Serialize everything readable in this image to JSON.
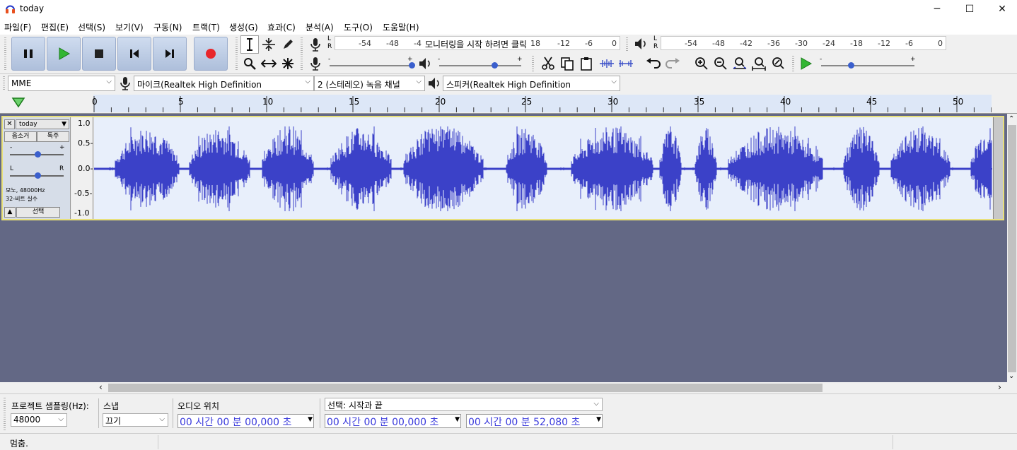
{
  "window": {
    "title": "today",
    "minimize": "─",
    "maximize": "☐",
    "close": "✕"
  },
  "menu": [
    "파일(F)",
    "편집(E)",
    "선택(S)",
    "보기(V)",
    "구동(N)",
    "트랙(T)",
    "생성(G)",
    "효과(C)",
    "분석(A)",
    "도구(O)",
    "도움말(H)"
  ],
  "meters": {
    "record_ticks": [
      "-54",
      "-48",
      "-4",
      "18",
      "-12",
      "-6",
      "0"
    ],
    "record_hint": "모니터링을 시작 하려면 클릭",
    "play_ticks": [
      "-54",
      "-48",
      "-42",
      "-36",
      "-30",
      "-24",
      "-18",
      "-12",
      "-6",
      "0"
    ],
    "lr": [
      "L",
      "R"
    ]
  },
  "sliders": {
    "minus": "-",
    "plus": "+"
  },
  "devices": {
    "host": "MME",
    "input": "마이크(Realtek High Definition",
    "channels": "2 (스테레오) 녹음 채널",
    "output": "스피커(Realtek High Definition"
  },
  "ruler": {
    "labels": [
      "0",
      "5",
      "10",
      "15",
      "20",
      "25",
      "30",
      "35",
      "40",
      "45",
      "50"
    ]
  },
  "track": {
    "name": "today",
    "mute": "음소거",
    "solo": "독주",
    "gain_minus": "-",
    "gain_plus": "+",
    "pan_left": "L",
    "pan_right": "R",
    "info1": "모노, 48000Hz",
    "info2": "32-비트 실수",
    "select": "선택",
    "vscale": [
      "1.0",
      "0.5-",
      "0.0-",
      "-0.5-",
      "-1.0"
    ]
  },
  "selection": {
    "rate_label": "프로젝트 샘플링(Hz):",
    "rate_value": "48000",
    "snap_label": "스냅",
    "snap_value": "끄기",
    "pos_label": "오디오 위치",
    "pos_value": "00 시간 00 분 00,000 초",
    "sel_label": "선택: 시작과 끝",
    "sel_start": "00 시간 00 분 00,000 초",
    "sel_end": "00 시간 00 분 52,080 초"
  },
  "status": "멈춤."
}
